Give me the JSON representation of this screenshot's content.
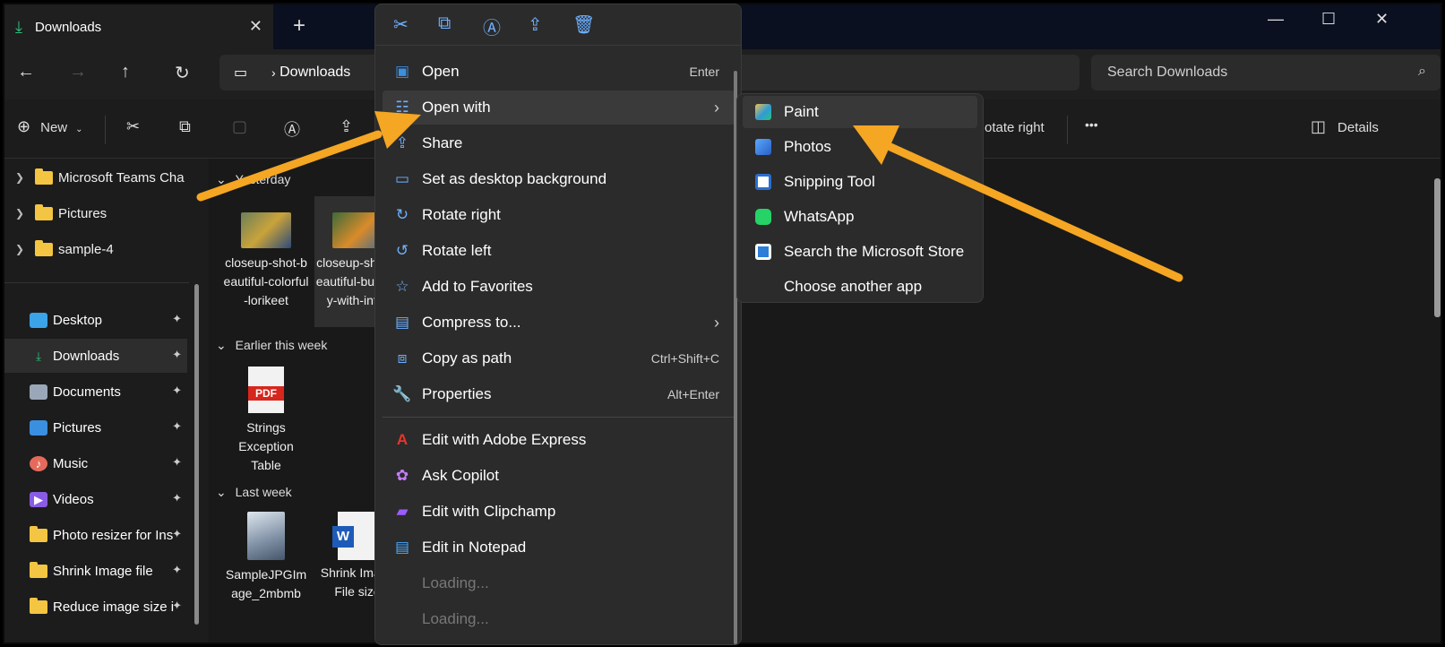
{
  "window": {
    "tab_title": "Downloads",
    "new_tab": "+",
    "controls": {
      "minimize": "—",
      "maximize": "☐",
      "close": "✕"
    }
  },
  "address": {
    "path": "Downloads",
    "search_placeholder": "Search Downloads"
  },
  "toolbar": {
    "new_label": "New",
    "rotate_right_label": "otate right",
    "more_label": "•••",
    "details_label": "Details"
  },
  "nav_tree": [
    {
      "label": "Microsoft Teams Cha"
    },
    {
      "label": "Pictures"
    },
    {
      "label": "sample-4"
    }
  ],
  "quick_access": [
    {
      "label": "Desktop",
      "icon": "desktop-icon",
      "color": "#3ba3e8"
    },
    {
      "label": "Downloads",
      "icon": "download-icon",
      "color": "#2ec27e",
      "selected": true
    },
    {
      "label": "Documents",
      "icon": "documents-icon",
      "color": "#9aa7b8"
    },
    {
      "label": "Pictures",
      "icon": "pictures-icon",
      "color": "#3b8fe0"
    },
    {
      "label": "Music",
      "icon": "music-icon",
      "color": "#e56a5c"
    },
    {
      "label": "Videos",
      "icon": "videos-icon",
      "color": "#8a5ce6"
    },
    {
      "label": "Photo resizer for Ins",
      "icon": "folder-icon",
      "color": "#f4c542"
    },
    {
      "label": "Shrink Image file",
      "icon": "folder-icon",
      "color": "#f4c542"
    },
    {
      "label": "Reduce image size i",
      "icon": "folder-icon",
      "color": "#f4c542"
    }
  ],
  "content": {
    "groups": {
      "yesterday": "Yesterday",
      "earlier": "Earlier this week",
      "last_week": "Last week"
    },
    "files": {
      "lorikeet": "closeup-shot-beautiful-colorful-lorikeet",
      "butterfly": "closeup-shot-beautiful-butterfly-with-inter",
      "pdf": "Strings Exception Table",
      "pdf_badge": "PDF",
      "jpg": "SampleJPGImage_2mbmb",
      "docx": "Shrink Image File size",
      "word_badge": "W"
    }
  },
  "context_menu": {
    "items": [
      {
        "label": "Open",
        "shortcut": "Enter",
        "icon": "open-icon"
      },
      {
        "label": "Open with",
        "submenu": true,
        "icon": "open-with-icon"
      },
      {
        "label": "Share",
        "icon": "share-icon"
      },
      {
        "label": "Set as desktop background",
        "icon": "desktop-background-icon"
      },
      {
        "label": "Rotate right",
        "icon": "rotate-right-icon"
      },
      {
        "label": "Rotate left",
        "icon": "rotate-left-icon"
      },
      {
        "label": "Add to Favorites",
        "icon": "star-icon"
      },
      {
        "label": "Compress to...",
        "submenu": true,
        "icon": "compress-icon"
      },
      {
        "label": "Copy as path",
        "shortcut": "Ctrl+Shift+C",
        "icon": "copy-path-icon"
      },
      {
        "label": "Properties",
        "shortcut": "Alt+Enter",
        "icon": "properties-icon"
      }
    ],
    "extra_items": [
      {
        "label": "Edit with Adobe Express",
        "icon": "adobe-icon"
      },
      {
        "label": "Ask Copilot",
        "icon": "copilot-icon"
      },
      {
        "label": "Edit with Clipchamp",
        "icon": "clipchamp-icon"
      },
      {
        "label": "Edit in Notepad",
        "icon": "notepad-icon"
      },
      {
        "label": "Loading...",
        "disabled": true
      },
      {
        "label": "Loading...",
        "disabled": true
      }
    ]
  },
  "open_with_submenu": [
    {
      "label": "Paint",
      "icon": "paint-icon",
      "color": "#2f9ad6"
    },
    {
      "label": "Photos",
      "icon": "photos-icon",
      "color": "#3b7fd8"
    },
    {
      "label": "Snipping Tool",
      "icon": "snipping-tool-icon",
      "color": "#2b6fce"
    },
    {
      "label": "WhatsApp",
      "icon": "whatsapp-icon",
      "color": "#25d366"
    },
    {
      "label": "Search the Microsoft Store",
      "icon": "store-icon",
      "color": "#2b7fd8"
    },
    {
      "label": "Choose another app",
      "icon": ""
    }
  ],
  "colors": {
    "arrow": "#f5a623",
    "accent": "#6fb0ff"
  }
}
